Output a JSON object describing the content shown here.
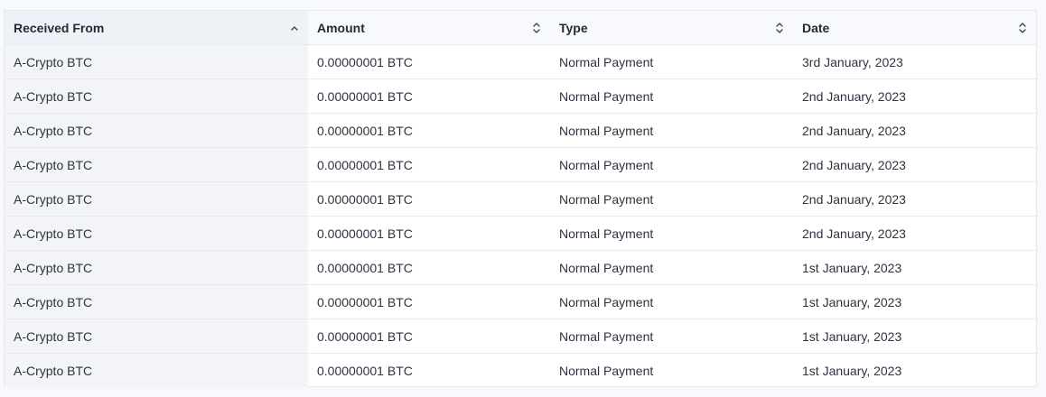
{
  "table": {
    "columns": [
      {
        "label": "Received From",
        "sort": "ascending",
        "icon": "chevron-up-icon"
      },
      {
        "label": "Amount",
        "sort": "none",
        "icon": "sort-updown-icon"
      },
      {
        "label": "Type",
        "sort": "none",
        "icon": "sort-updown-icon"
      },
      {
        "label": "Date",
        "sort": "none",
        "icon": "sort-updown-icon"
      }
    ],
    "rows": [
      {
        "from": "A-Crypto BTC",
        "amount": "0.00000001 BTC",
        "type": "Normal Payment",
        "date": "3rd January, 2023"
      },
      {
        "from": "A-Crypto BTC",
        "amount": "0.00000001 BTC",
        "type": "Normal Payment",
        "date": "2nd January, 2023"
      },
      {
        "from": "A-Crypto BTC",
        "amount": "0.00000001 BTC",
        "type": "Normal Payment",
        "date": "2nd January, 2023"
      },
      {
        "from": "A-Crypto BTC",
        "amount": "0.00000001 BTC",
        "type": "Normal Payment",
        "date": "2nd January, 2023"
      },
      {
        "from": "A-Crypto BTC",
        "amount": "0.00000001 BTC",
        "type": "Normal Payment",
        "date": "2nd January, 2023"
      },
      {
        "from": "A-Crypto BTC",
        "amount": "0.00000001 BTC",
        "type": "Normal Payment",
        "date": "2nd January, 2023"
      },
      {
        "from": "A-Crypto BTC",
        "amount": "0.00000001 BTC",
        "type": "Normal Payment",
        "date": "1st January, 2023"
      },
      {
        "from": "A-Crypto BTC",
        "amount": "0.00000001 BTC",
        "type": "Normal Payment",
        "date": "1st January, 2023"
      },
      {
        "from": "A-Crypto BTC",
        "amount": "0.00000001 BTC",
        "type": "Normal Payment",
        "date": "1st January, 2023"
      },
      {
        "from": "A-Crypto BTC",
        "amount": "0.00000001 BTC",
        "type": "Normal Payment",
        "date": "1st January, 2023"
      }
    ]
  },
  "colors": {
    "page_bg": "#f7f9fc",
    "sorted_column_bg": "#f2f4f7",
    "text": "#1f2a37",
    "border": "#e3e8ef"
  }
}
